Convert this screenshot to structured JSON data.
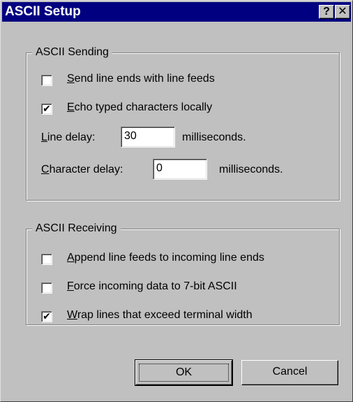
{
  "window": {
    "title": "ASCII Setup",
    "help_button": "?",
    "close_button": "✕"
  },
  "sending": {
    "legend": "ASCII Sending",
    "line_ends": {
      "label_key": "S",
      "label_rest": "end line ends with line feeds",
      "checked": false
    },
    "echo": {
      "label_key": "E",
      "label_rest": "cho typed characters locally",
      "checked": true,
      "mark": "✔"
    },
    "line_delay": {
      "label_key": "L",
      "label_rest": "ine delay:",
      "value": "30",
      "unit": "milliseconds."
    },
    "char_delay": {
      "label_key": "C",
      "label_rest": "haracter delay:",
      "value": "0",
      "unit": "milliseconds."
    }
  },
  "receiving": {
    "legend": "ASCII Receiving",
    "append": {
      "label_key": "A",
      "label_rest": "ppend line feeds to incoming line ends",
      "checked": false
    },
    "force7bit": {
      "label_key": "F",
      "label_rest": "orce incoming data to 7-bit ASCII",
      "checked": false
    },
    "wrap": {
      "label_key": "W",
      "label_rest": "rap lines that exceed terminal width",
      "checked": true,
      "mark": "✔"
    }
  },
  "buttons": {
    "ok": "OK",
    "cancel": "Cancel"
  }
}
